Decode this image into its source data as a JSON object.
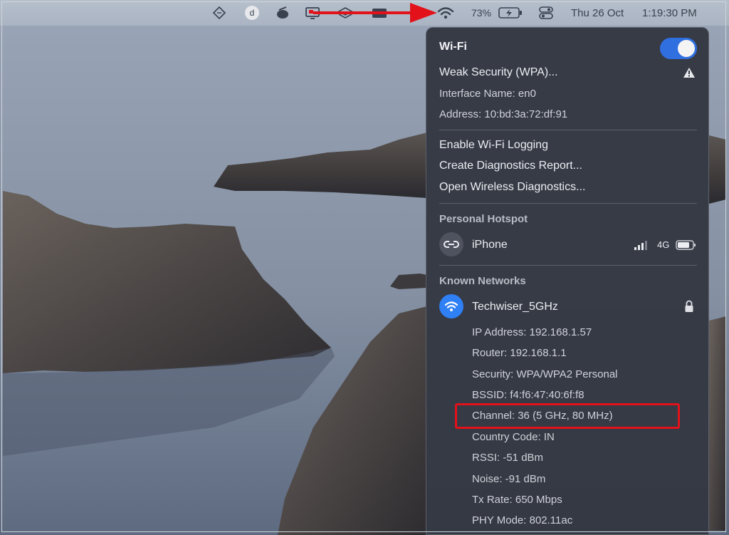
{
  "menubar": {
    "battery": "73%",
    "date": "Thu 26 Oct",
    "time": "1:19:30 PM",
    "extra_icon_letter": "d"
  },
  "wifi_menu": {
    "title": "Wi-Fi",
    "toggle_on": true,
    "weak_security": "Weak Security (WPA)...",
    "interface_name": "Interface Name: en0",
    "address": "Address: 10:bd:3a:72:df:91",
    "actions": [
      "Enable Wi-Fi Logging",
      "Create Diagnostics Report...",
      "Open Wireless Diagnostics..."
    ],
    "hotspot": {
      "header": "Personal Hotspot",
      "device": "iPhone",
      "network_type": "4G"
    },
    "known": {
      "header": "Known Networks",
      "network": "Techwiser_5GHz",
      "details": [
        "IP Address: 192.168.1.57",
        "Router: 192.168.1.1",
        "Security: WPA/WPA2 Personal",
        "BSSID: f4:f6:47:40:6f:f8",
        "Channel: 36 (5 GHz, 80 MHz)",
        "Country Code: IN",
        "RSSI: -51 dBm",
        "Noise: -91 dBm",
        "Tx Rate: 650 Mbps",
        "PHY Mode: 802.11ac"
      ]
    }
  },
  "colors": {
    "accent": "#2f6fe0",
    "highlight": "#e3111a",
    "panel_bg": "#343842"
  }
}
